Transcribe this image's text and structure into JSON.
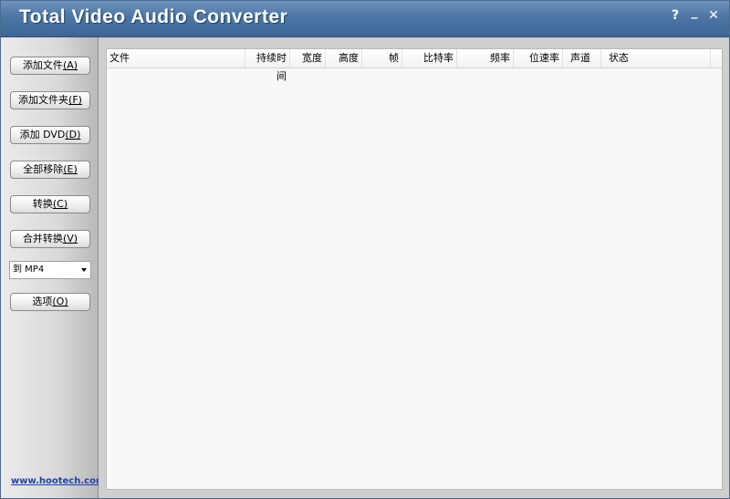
{
  "window": {
    "title": "Total Video Audio Converter",
    "help_glyph": "?",
    "minimize_glyph": "_",
    "close_glyph": "✕"
  },
  "sidebar": {
    "buttons": [
      {
        "label": "添加文件",
        "hotkey": "(A)"
      },
      {
        "label": "添加文件夹",
        "hotkey": "(F)"
      },
      {
        "label": "添加 DVD",
        "hotkey": "(D)"
      },
      {
        "label": "全部移除",
        "hotkey": "(E)"
      },
      {
        "label": "转换",
        "hotkey": "(C)"
      },
      {
        "label": "合并转换",
        "hotkey": "(V)"
      }
    ],
    "format_select": {
      "value": "到 MP4"
    },
    "options_button": {
      "label": "选项",
      "hotkey": "(O)"
    },
    "website": "www.hootech.com"
  },
  "list": {
    "columns": [
      "文件",
      "持续时间",
      "宽度",
      "高度",
      "帧",
      "比特率",
      "频率",
      "位速率",
      "声道",
      "状态"
    ],
    "rows": []
  },
  "colors": {
    "titlebar": "#4d76a5",
    "link": "#1f3fae"
  }
}
